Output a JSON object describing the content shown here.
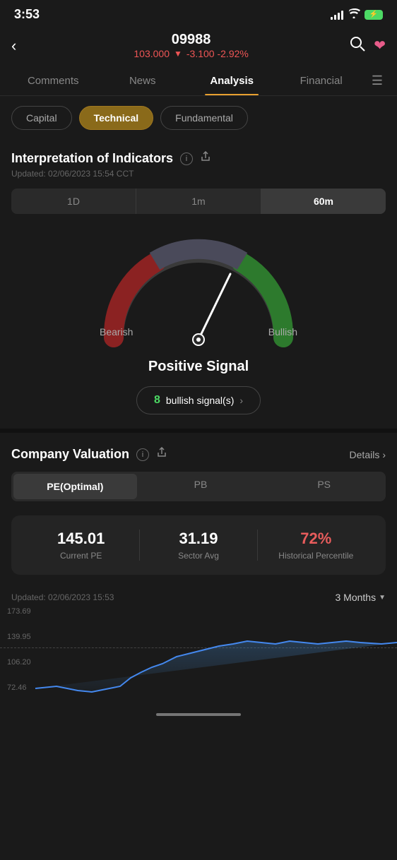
{
  "statusBar": {
    "time": "3:53"
  },
  "header": {
    "back": "<",
    "stockCode": "09988",
    "price": "103.000",
    "arrow": "▼",
    "change": "-3.100 -2.92%"
  },
  "navTabs": {
    "tabs": [
      "Comments",
      "News",
      "Analysis",
      "Financial"
    ],
    "activeTab": "Analysis"
  },
  "subTabs": {
    "tabs": [
      "Capital",
      "Technical",
      "Fundamental"
    ],
    "activeTab": "Technical"
  },
  "indicators": {
    "title": "Interpretation of Indicators",
    "updated": "Updated: 02/06/2023 15:54 CCT",
    "timePeriods": [
      "1D",
      "1m",
      "60m"
    ],
    "activePeriod": "60m",
    "bearishLabel": "Bearish",
    "bullishLabel": "Bullish",
    "signal": "Positive Signal",
    "bullishCount": "8",
    "bullishText": "bullish signal(s)"
  },
  "valuation": {
    "title": "Company Valuation",
    "detailsLabel": "Details",
    "peTabs": [
      "PE(Optimal)",
      "PB",
      "PS"
    ],
    "activePeTab": "PE(Optimal)",
    "currentPE": "145.01",
    "currentPELabel": "Current PE",
    "sectorAvg": "31.19",
    "sectorAvgLabel": "Sector Avg",
    "historicalPct": "72%",
    "historicalPctLabel": "Historical Percentile",
    "updatedChart": "Updated:  02/06/2023 15:53",
    "monthsSelector": "3 Months",
    "chartValues": {
      "high": "173.69",
      "mid1": "139.95",
      "mid2": "106.20",
      "low": "72.46"
    }
  }
}
